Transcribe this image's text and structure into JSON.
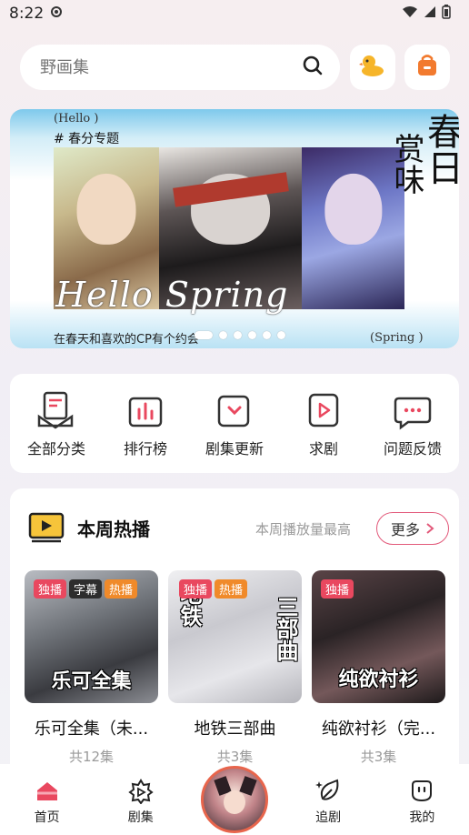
{
  "status_bar": {
    "time": "8:22"
  },
  "search": {
    "placeholder": "野画集"
  },
  "banner": {
    "hello": "(Hello )",
    "theme": "# 春分专题",
    "script": "Hello Spring",
    "vertical_1": "赏味",
    "vertical_2": "春日",
    "caption": "在春天和喜欢的CP有个约会",
    "spring": "(Spring )",
    "slide_count": 6,
    "active_slide": 1
  },
  "categories": [
    {
      "label": "全部分类",
      "icon": "category-icon"
    },
    {
      "label": "排行榜",
      "icon": "ranking-icon"
    },
    {
      "label": "剧集更新",
      "icon": "update-icon"
    },
    {
      "label": "求剧",
      "icon": "request-icon"
    },
    {
      "label": "问题反馈",
      "icon": "feedback-icon"
    }
  ],
  "hot": {
    "title": "本周热播",
    "subtitle": "本周播放量最高",
    "more_label": "更多",
    "items": [
      {
        "name": "乐可全集（未...",
        "episodes": "共12集",
        "cover_text": "乐可全集",
        "badges": [
          {
            "text": "独播",
            "color": "#e9485f"
          },
          {
            "text": "字幕",
            "color": "#2d2d2d"
          },
          {
            "text": "热播",
            "color": "#f08a2a"
          }
        ]
      },
      {
        "name": "地铁三部曲",
        "episodes": "共3集",
        "cover_text_left": "地铁",
        "cover_text_right": "三部曲",
        "badges": [
          {
            "text": "独播",
            "color": "#e9485f"
          },
          {
            "text": "热播",
            "color": "#f08a2a"
          }
        ]
      },
      {
        "name": "纯欲衬衫（完...",
        "episodes": "共3集",
        "cover_text": "纯欲衬衫",
        "badges": [
          {
            "text": "独播",
            "color": "#e9485f"
          }
        ]
      }
    ]
  },
  "nav": {
    "home": "首页",
    "series": "剧集",
    "follow": "追剧",
    "mine": "我的"
  },
  "colors": {
    "accent": "#e9485f",
    "hot_badge": "#f08a2a",
    "more_border": "#e2597a",
    "banner_blue": "#7ec9ec"
  }
}
